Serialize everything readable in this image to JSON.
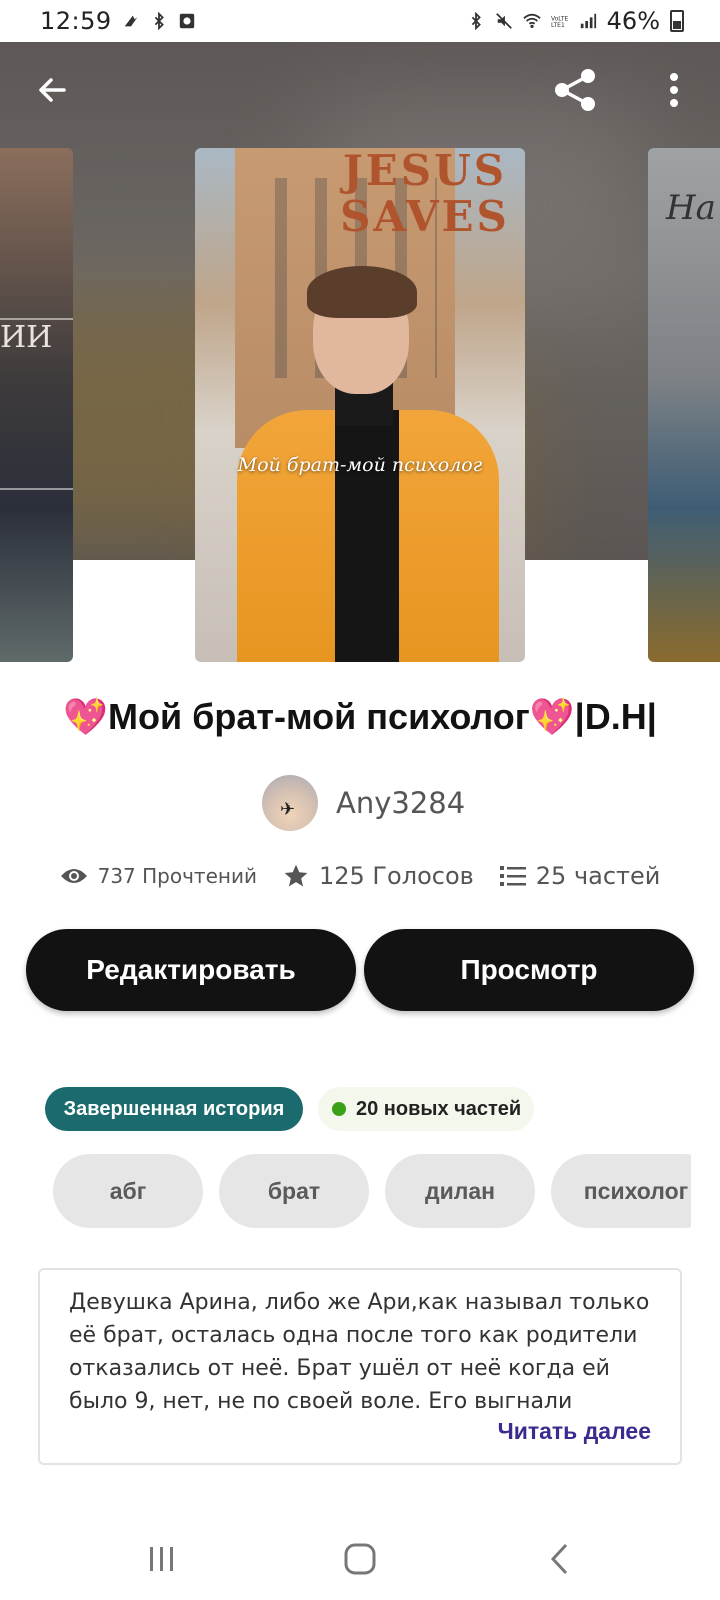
{
  "status_bar": {
    "time": "12:59",
    "battery": "46%",
    "icons_left": [
      "gesture-icon",
      "bluetooth-icon",
      "screen-record-icon"
    ],
    "icons_right": [
      "bluetooth-icon",
      "mute-icon",
      "wifi-icon",
      "volte-lte-icon",
      "signal-icon",
      "battery-icon"
    ]
  },
  "topbar": {
    "back_icon": "arrow-left-icon",
    "share_icon": "share-icon",
    "more_icon": "more-vertical-icon"
  },
  "covers": {
    "left_text": "ИИ",
    "main_sign": "JESUS SAVES",
    "main_title": "Мой брат-мой психолог",
    "right_text": "На"
  },
  "story": {
    "title": "💖Мой брат-мой психолог💖|D.H|",
    "author": "Any3284"
  },
  "stats": {
    "reads": "737 Прочтений",
    "votes": "125 Голосов",
    "parts": "25 частей"
  },
  "actions": {
    "edit_label": "Редактировать",
    "preview_label": "Просмотр"
  },
  "badges": {
    "complete": "Завершенная история",
    "new_parts": "20 новых частей"
  },
  "tags": [
    "абг",
    "брат",
    "дилан",
    "психолог"
  ],
  "description": {
    "text": "Девушка Арина, либо же Ари,как называл только её брат, осталась одна после того как родители отказались от неё. Брат ушёл от неё когда ей было 9, нет, не по своей воле. Его выгнали родители,",
    "read_more": "Читать далее"
  },
  "colors": {
    "accent_teal": "#1b6a6d",
    "read_more": "#3c2a8f",
    "button_dark": "#121212",
    "new_dot": "#3aa018"
  }
}
